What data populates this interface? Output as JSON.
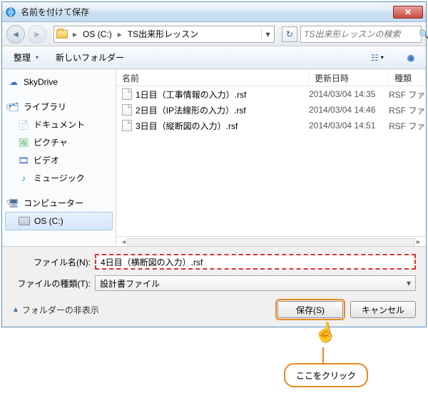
{
  "window": {
    "title": "名前を付けて保存"
  },
  "nav": {
    "path_drive": "OS (C:)",
    "path_folder": "TS出来形レッスン",
    "search_placeholder": "TS出来形レッスンの検索"
  },
  "toolbar": {
    "organize": "整理",
    "newfolder": "新しいフォルダー"
  },
  "sidebar": {
    "skydrive": "SkyDrive",
    "library": "ライブラリ",
    "documents": "ドキュメント",
    "pictures": "ピクチャ",
    "videos": "ビデオ",
    "music": "ミュージック",
    "computer": "コンピューター",
    "os_c": "OS (C:)"
  },
  "columns": {
    "name": "名前",
    "date": "更新日時",
    "type": "種類"
  },
  "files": [
    {
      "name": "1日目（工事情報の入力）.rsf",
      "date": "2014/03/04 14:35",
      "type": "RSF ファ"
    },
    {
      "name": "2日目（IP法線形の入力）.rsf",
      "date": "2014/03/04 14:46",
      "type": "RSF ファ"
    },
    {
      "name": "3日目（縦断図の入力）.rsf",
      "date": "2014/03/04 14:51",
      "type": "RSF ファ"
    }
  ],
  "fields": {
    "filename_label": "ファイル名(N):",
    "filename_value": "4日目（横断図の入力）.rsf",
    "filetype_label": "ファイルの種類(T):",
    "filetype_value": "設計書ファイル"
  },
  "actions": {
    "hide_folders": "フォルダーの非表示",
    "save": "保存(S)",
    "cancel": "キャンセル"
  },
  "annotation": {
    "text": "ここをクリック"
  }
}
